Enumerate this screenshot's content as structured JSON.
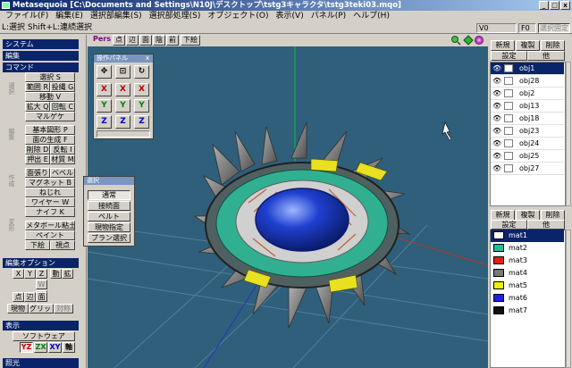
{
  "window": {
    "title": "Metasequoia [C:\\Documents and Settings\\N10J\\デスクトップ\\tstg3キャラクタ\\tstg3teki03.mqo]",
    "min": "_",
    "max": "□",
    "close": "x"
  },
  "menu": [
    "ファイル(F)",
    "編集(E)",
    "選択部編集(S)",
    "選択部処理(S)",
    "オブジェクト(O)",
    "表示(V)",
    "パネル(P)",
    "ヘルプ(H)"
  ],
  "status": {
    "hint": "L:選択  Shift+L:連続選択",
    "v_label": "V0",
    "f_label": "F0",
    "fix_label": "選択固定"
  },
  "left": {
    "system": "システム",
    "edit": "編集",
    "command": "コマンド",
    "side_labels": [
      "選択",
      "編集",
      "作成",
      "変形",
      "曲面"
    ],
    "cmd_buttons": [
      "選択 S",
      "範囲 R",
      "投縄 G",
      "移動 V",
      "拡大 Q",
      "回転 C",
      "マルゲケ",
      "基本図形 P",
      "面の生成 F",
      "削除 D",
      "反転 I",
      "押出 E",
      "材質 M",
      "面張り",
      "ベベル",
      "マグネット B",
      "ねじれ",
      "ワイヤー W",
      "ナイフ K",
      "メタボール粘土",
      "ペイント",
      "下絵",
      "視点"
    ],
    "editopt": "編集オプション",
    "editopt_buttons": [
      "X",
      "Y",
      "Z",
      "動",
      "拡",
      "W",
      "S",
      "点",
      "辺",
      "面",
      "現物",
      "グリッド",
      "対称"
    ],
    "display": "表示",
    "software": "ソフトウェア",
    "axes": [
      "YZ",
      "ZX",
      "XY",
      "軸"
    ],
    "lighting": "照光"
  },
  "viewport": {
    "pers": "Pers",
    "modes": [
      "点",
      "辺",
      "面",
      "陰",
      "前",
      "下絵"
    ],
    "nav_icons": [
      "zoom-icon",
      "move-icon",
      "rotate-icon"
    ]
  },
  "op_panel": {
    "title": "操作パネル",
    "close": "x",
    "axes": [
      "X",
      "Y",
      "Z"
    ]
  },
  "select_popup": {
    "title": "選択",
    "items": [
      "通常",
      "接続面",
      "ベルト",
      "現物指定",
      "プラン選択"
    ]
  },
  "obj_panel": {
    "buttons": [
      "新規",
      "複製",
      "削除",
      "設定",
      "他"
    ],
    "items": [
      "obj1",
      "obj28",
      "obj2",
      "obj13",
      "obj18",
      "obj23",
      "obj24",
      "obj25",
      "obj27"
    ]
  },
  "mat_panel": {
    "buttons": [
      "新規",
      "複製",
      "削除",
      "設定",
      "他"
    ],
    "items": [
      {
        "name": "mat1",
        "color": "#ffffff"
      },
      {
        "name": "mat2",
        "color": "#20c090"
      },
      {
        "name": "mat3",
        "color": "#e02010"
      },
      {
        "name": "mat4",
        "color": "#787878"
      },
      {
        "name": "mat5",
        "color": "#f0f000"
      },
      {
        "name": "mat6",
        "color": "#2020e0"
      },
      {
        "name": "mat7",
        "color": "#101010"
      }
    ]
  }
}
